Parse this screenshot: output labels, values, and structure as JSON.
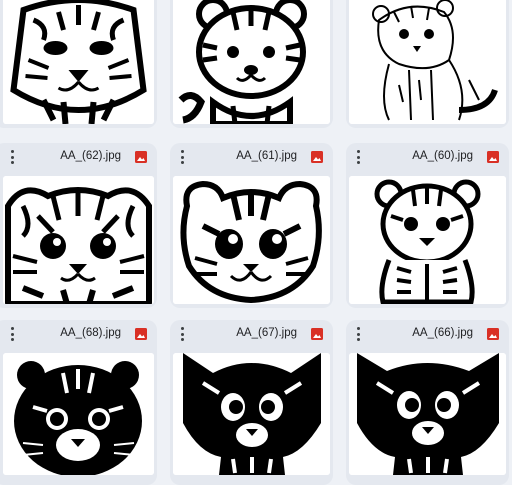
{
  "icons": {
    "menu": "more-vert-icon",
    "image": "image-file-icon"
  },
  "colors": {
    "image_icon": "#d93025",
    "card_bg": "#e4e8ef",
    "page_bg": "#eef1f6"
  },
  "files": [
    {
      "name": "",
      "art": "tiger-face-line-art"
    },
    {
      "name": "",
      "art": "cartoon-tiger-cub-line-art"
    },
    {
      "name": "",
      "art": "sitting-tiger-cub-sketch"
    },
    {
      "name": "AA_(62).jpg",
      "art": "tiger-cub-face-line-art"
    },
    {
      "name": "AA_(61).jpg",
      "art": "smiling-tiger-cub-line-art"
    },
    {
      "name": "AA_(60).jpg",
      "art": "seated-tiger-cub-line-art"
    },
    {
      "name": "AA_(68).jpg",
      "art": "black-silhouette-tiger-cub"
    },
    {
      "name": "AA_(67).jpg",
      "art": "black-silhouette-tiger-kitten"
    },
    {
      "name": "AA_(66).jpg",
      "art": "black-silhouette-tiger-kitten-alt"
    }
  ]
}
